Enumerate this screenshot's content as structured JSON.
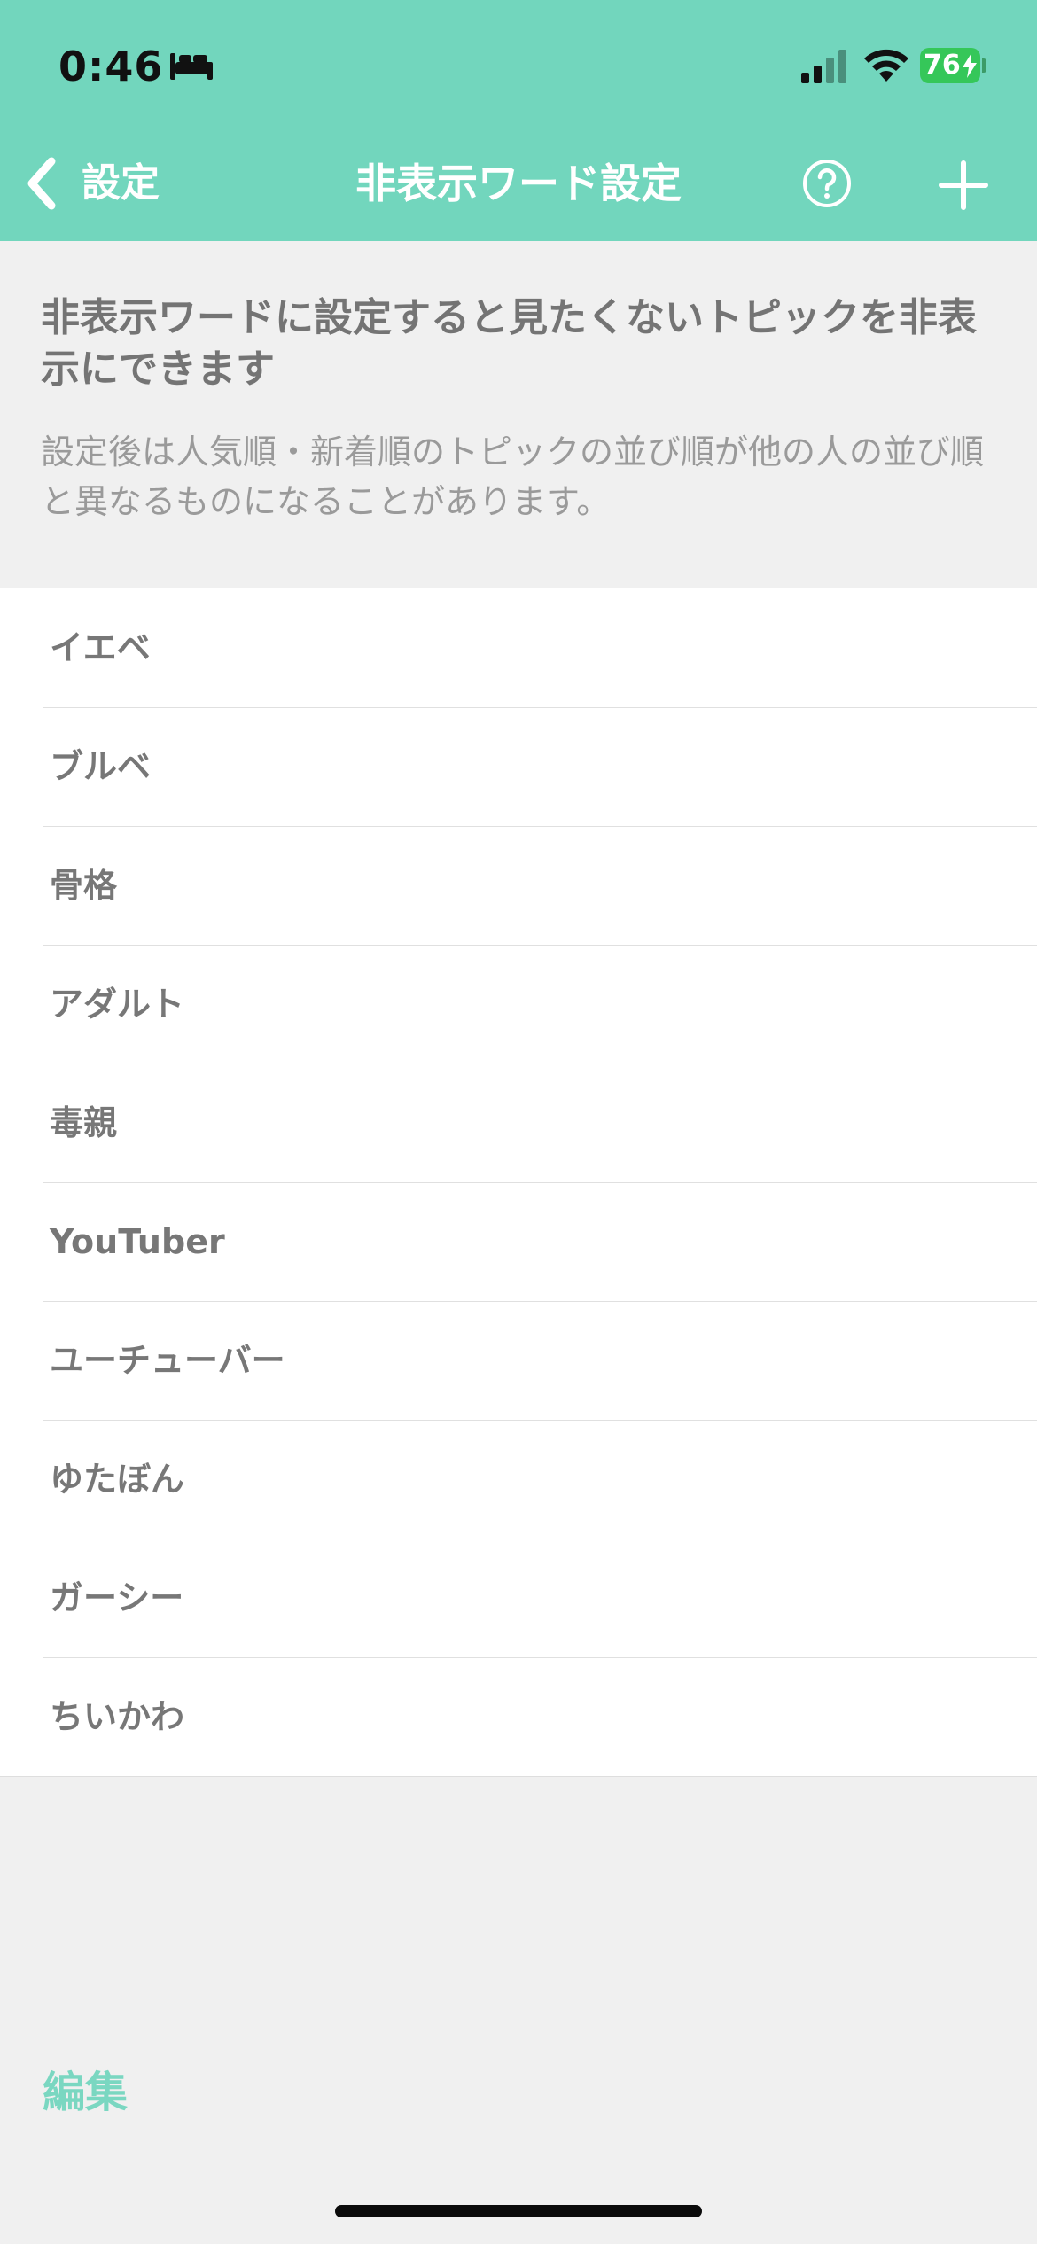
{
  "status_bar": {
    "time": "0:46",
    "battery": "76",
    "icons": [
      "bed-icon",
      "cellular-signal-icon",
      "wifi-icon",
      "battery-charging-icon"
    ]
  },
  "nav": {
    "back_label": "設定",
    "title": "非表示ワード設定",
    "help_icon": "question-circle-icon",
    "add_icon": "plus-icon"
  },
  "intro": {
    "title": "非表示ワードに設定すると見たくないトピックを非表示にできます",
    "body": "設定後は人気順・新着順のトピックの並び順が他の人の並び順と異なるものになることがあります。"
  },
  "hidden_words": [
    {
      "label": "イエベ"
    },
    {
      "label": "ブルベ"
    },
    {
      "label": "骨格"
    },
    {
      "label": "アダルト"
    },
    {
      "label": "毒親"
    },
    {
      "label": "YouTuber"
    },
    {
      "label": "ユーチューバー"
    },
    {
      "label": "ゆたぼん"
    },
    {
      "label": "ガーシー"
    },
    {
      "label": "ちいかわ"
    }
  ],
  "footer": {
    "edit_label": "編集"
  },
  "colors": {
    "header": "#72d6bd",
    "accent": "#7ad7c1",
    "background": "#f0f0f0"
  }
}
